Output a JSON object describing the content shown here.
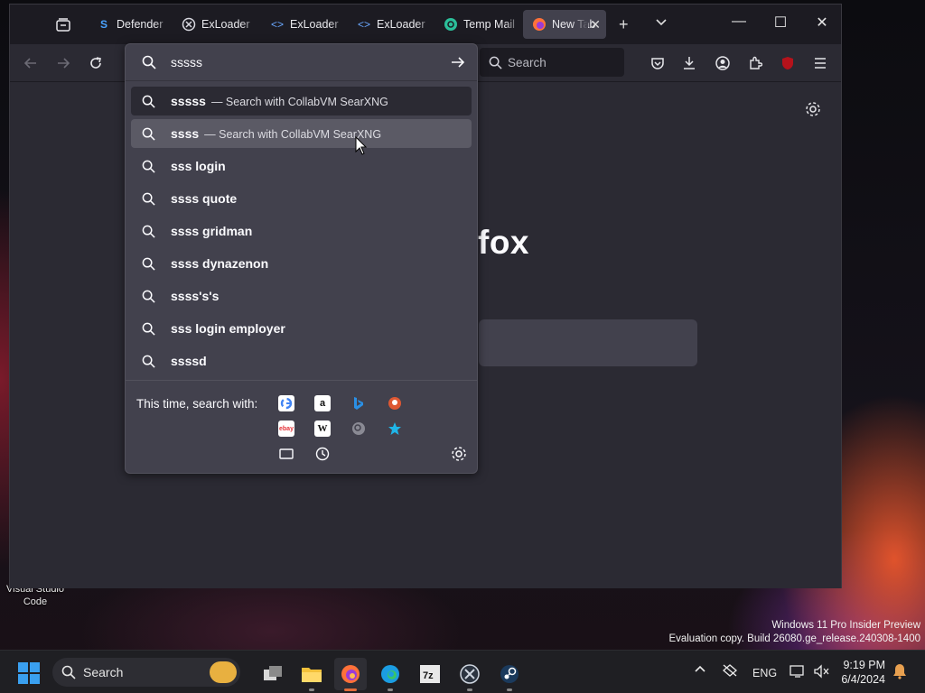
{
  "desktop": {
    "icon_label": "Visual Studio Code",
    "watermark_line1": "Windows 11 Pro Insider Preview",
    "watermark_line2": "Evaluation copy. Build 26080.ge_release.240308-1400"
  },
  "browser": {
    "tabs": [
      {
        "label": "Defender",
        "icon": "defender-icon",
        "color": "#4aa3ff"
      },
      {
        "label": "ExLoader",
        "icon": "exloader-icon",
        "color": "#d9d9e0"
      },
      {
        "label": "ExLoader",
        "icon": "code-icon",
        "color": "#6aa8ff"
      },
      {
        "label": "ExLoader",
        "icon": "code-icon",
        "color": "#6aa8ff"
      },
      {
        "label": "Temp Mail",
        "icon": "tempmail-icon",
        "color": "#2bbf9a"
      },
      {
        "label": "New Tab",
        "icon": "firefox-icon",
        "color": "#ff7139"
      }
    ],
    "toolbar": {
      "search_placeholder": "Search"
    },
    "content": {
      "brand_fragment": "fox"
    },
    "urlbar": {
      "value": "sssss",
      "results": [
        {
          "text": "sssss",
          "suffix": "— Search with CollabVM SearXNG"
        },
        {
          "text": "ssss",
          "suffix": "— Search with CollabVM SearXNG"
        },
        {
          "text": "sss login",
          "suffix": ""
        },
        {
          "text": "ssss quote",
          "suffix": ""
        },
        {
          "text": "ssss gridman",
          "suffix": ""
        },
        {
          "text": "ssss dynazenon",
          "suffix": ""
        },
        {
          "text": "ssss's's",
          "suffix": ""
        },
        {
          "text": "sss login employer",
          "suffix": ""
        },
        {
          "text": "ssssd",
          "suffix": ""
        }
      ],
      "oneoff_label": "This time, search with:",
      "engines": [
        "google",
        "amazon",
        "bing",
        "duckduckgo",
        "ebay",
        "wikipedia",
        "searxng",
        "bookmarks",
        "tabs",
        "history"
      ]
    }
  },
  "taskbar": {
    "search_label": "Search",
    "language": "ENG",
    "time": "9:19 PM",
    "date": "6/4/2024"
  },
  "colors": {
    "accent_firefox": "#ff7139",
    "windows_blue": "#3aa0f0",
    "urlbar_bg": "#42414d",
    "toolbar_bg": "#2b2a33"
  }
}
